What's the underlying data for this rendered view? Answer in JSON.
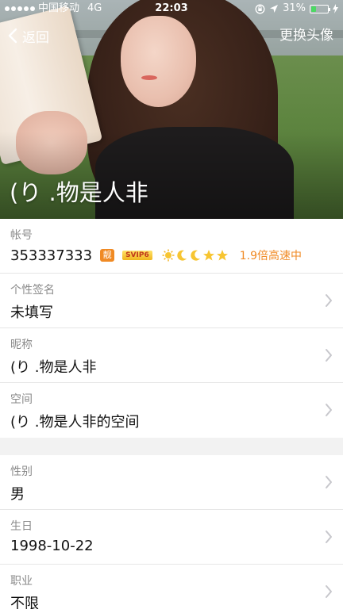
{
  "status_bar": {
    "carrier": "中国移动",
    "network": "4G",
    "time": "22:03",
    "battery_percent": "31%",
    "battery_level": 0.31
  },
  "nav": {
    "back_label": "返回",
    "change_avatar_label": "更换头像"
  },
  "profile": {
    "display_name": "(り .物是人非"
  },
  "account": {
    "label": "帐号",
    "number": "353337333",
    "liang_badge": "靓",
    "svip_badge": "SVIP6",
    "level_icons": [
      "sun-icon",
      "moon-icon",
      "moon-icon",
      "star-icon",
      "star-icon"
    ],
    "speed_text": "1.9倍高速中"
  },
  "fields": [
    {
      "label": "个性签名",
      "value": "未填写"
    },
    {
      "label": "昵称",
      "value": "(り .物是人非"
    },
    {
      "label": "空间",
      "value": "(り .物是人非的空间"
    }
  ],
  "fields2": [
    {
      "label": "性别",
      "value": "男"
    },
    {
      "label": "生日",
      "value": "1998-10-22"
    },
    {
      "label": "职业",
      "value": "不限"
    }
  ],
  "colors": {
    "accent_orange": "#f08a24",
    "battery_green": "#4cd964",
    "label_gray": "#8a8a8a"
  }
}
